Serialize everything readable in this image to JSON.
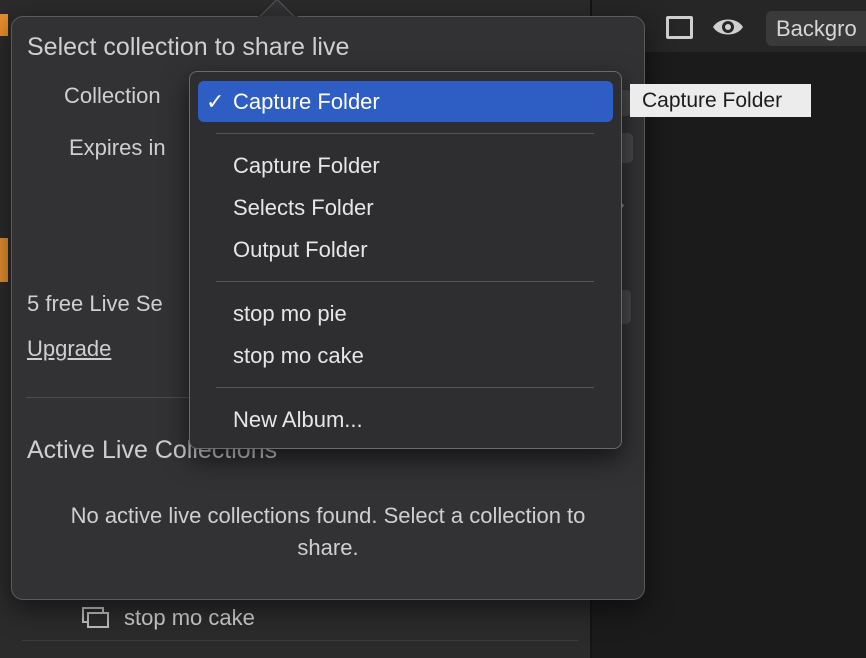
{
  "background_app": {
    "toolbar_button": "Backgro",
    "icons": {
      "frame": "frame-icon",
      "eye": "eye-icon",
      "collection": "collection-icon"
    },
    "list_row_label": "stop mo cake"
  },
  "share_popover": {
    "title": "Select collection to share live",
    "collection_label": "Collection",
    "expires_label": "Expires in",
    "free_sessions_text": "5 free Live Se",
    "upgrade_link": "Upgrade",
    "active_heading": "Active Live Collections",
    "empty_message": "No active live collections found. Select a collection to share."
  },
  "collection_menu": {
    "selected": {
      "check": "✓",
      "label": "Capture Folder"
    },
    "groups": [
      [
        "Capture Folder",
        "Selects Folder",
        "Output Folder"
      ],
      [
        "stop mo pie",
        "stop mo cake"
      ],
      [
        "New Album..."
      ]
    ]
  },
  "tooltip": {
    "text": "Capture Folder"
  },
  "colors": {
    "accent_orange": "#e8902f",
    "menu_selection": "#2e5ec4",
    "popover_bg": "#323234"
  }
}
